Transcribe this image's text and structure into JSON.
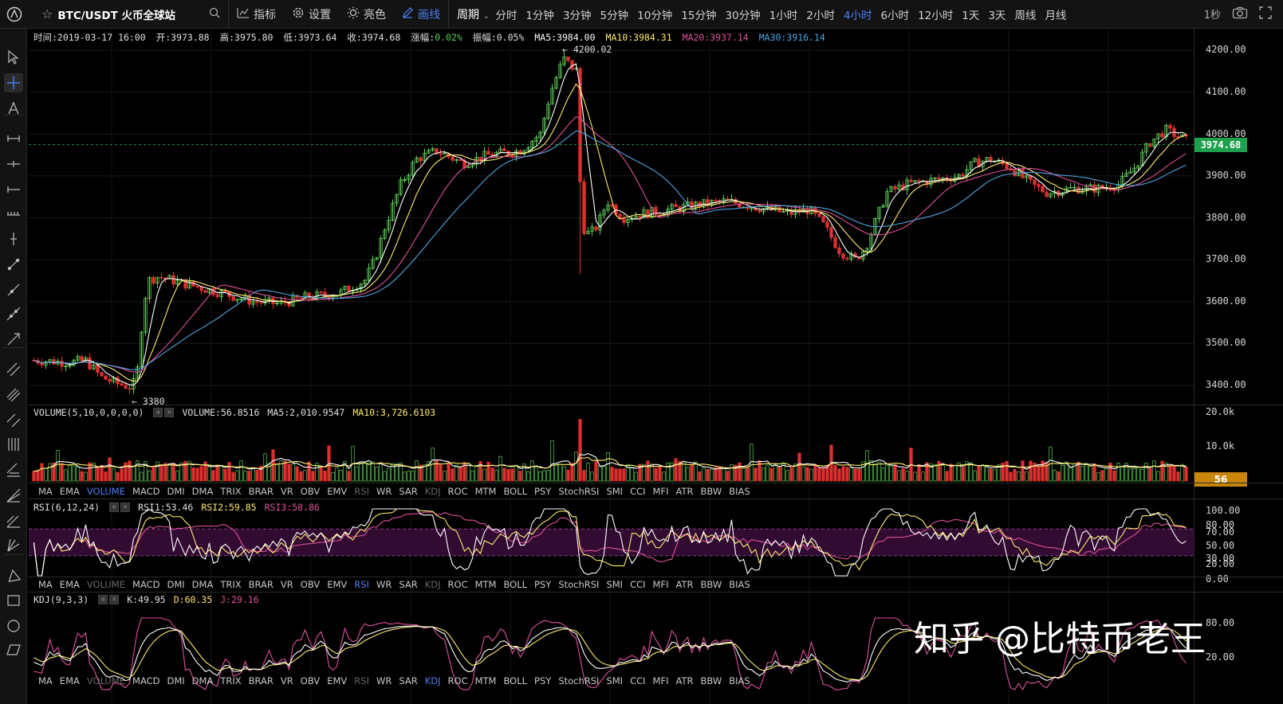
{
  "header": {
    "symbol": "BTC/USDT 火币全球站",
    "indicators_label": "指标",
    "settings_label": "设置",
    "theme_label": "亮色",
    "draw_label": "画线",
    "period_label": "周期",
    "periods": [
      "分时",
      "1分钟",
      "3分钟",
      "5分钟",
      "10分钟",
      "15分钟",
      "30分钟",
      "1小时",
      "2小时",
      "4小时",
      "6小时",
      "12小时",
      "1天",
      "3天",
      "周线",
      "月线"
    ],
    "active_period": "4小时",
    "interval": "1秒"
  },
  "ohlc": {
    "time": "时间:2019-03-17 16:00",
    "open": "开:3973.88",
    "high": "高:3975.80",
    "low": "低:3973.64",
    "close": "收:3974.68",
    "change_label": "涨幅:",
    "change_value": "0.02%",
    "amplitude": "振幅:0.05%",
    "ma5": "MA5:3984.00",
    "ma10": "MA10:3984.31",
    "ma20": "MA20:3937.14",
    "ma30": "MA30:3916.14"
  },
  "price_axis": [
    "4200.00",
    "4100.00",
    "4000.00",
    "3900.00",
    "3800.00",
    "3700.00",
    "3600.00",
    "3500.00",
    "3400.00"
  ],
  "current_price": "3974.68",
  "high_annotation": "← 4200.02",
  "low_annotation": "← 3380",
  "volume": {
    "title": "VOLUME(5,10,0,0,0,0)",
    "value": "VOLUME:56.8516",
    "ma5": "MA5:2,010.9547",
    "ma10": "MA10:3,726.6103",
    "axis": [
      "20.0k",
      "10.0k"
    ],
    "current": "56"
  },
  "rsi": {
    "title": "RSI(6,12,24)",
    "rsi1": "RSI1:53.46",
    "rsi2": "RSI2:59.85",
    "rsi3": "RSI3:58.86",
    "axis": [
      "100.00",
      "80.00",
      "70.00",
      "50.00",
      "30.00",
      "20.00",
      "0.00"
    ]
  },
  "kdj": {
    "title": "KDJ(9,3,3)",
    "k": "K:49.95",
    "d": "D:60.35",
    "j": "J:29.16",
    "axis": [
      "80.00",
      "20.00"
    ]
  },
  "indicator_tabs": [
    "MA",
    "EMA",
    "VOLUME",
    "MACD",
    "DMI",
    "DMA",
    "TRIX",
    "BRAR",
    "VR",
    "OBV",
    "EMV",
    "RSI",
    "WR",
    "SAR",
    "KDJ",
    "ROC",
    "MTM",
    "BOLL",
    "PSY",
    "StochRSI",
    "SMI",
    "CCI",
    "MFI",
    "ATR",
    "BBW",
    "BIAS"
  ],
  "watermark": "知乎 @比特币老王",
  "colors": {
    "up": "#5fd35a",
    "down": "#e02f2f",
    "ma5": "#ffffff",
    "ma10": "#ffeb6b",
    "ma20": "#e0509a",
    "ma30": "#4ea4e0",
    "accent": "#4a7ff5"
  }
}
